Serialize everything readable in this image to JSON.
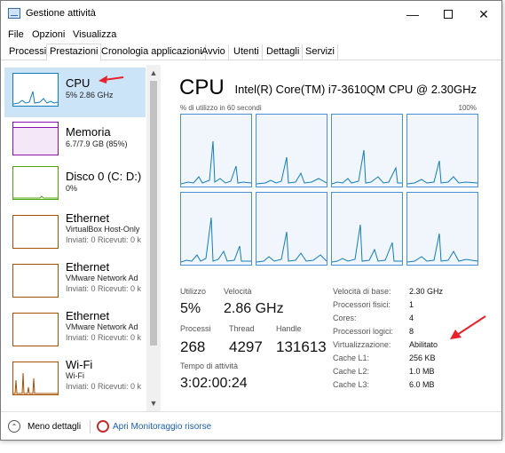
{
  "window": {
    "title": "Gestione attività"
  },
  "menu": [
    "File",
    "Opzioni",
    "Visualizza"
  ],
  "tabs": [
    "Processi",
    "Prestazioni",
    "Cronologia applicazioni",
    "Avvio",
    "Utenti",
    "Dettagli",
    "Servizi"
  ],
  "active_tab": "Prestazioni",
  "sidebar": {
    "items": [
      {
        "title": "CPU",
        "line1": "5% 2.86 GHz",
        "line2": "",
        "color": "#117dbb"
      },
      {
        "title": "Memoria",
        "line1": "6.7/7.9 GB (85%)",
        "line2": "",
        "color": "#8b12ae"
      },
      {
        "title": "Disco 0 (C: D:)",
        "line1": "0%",
        "line2": "",
        "color": "#4da60c"
      },
      {
        "title": "Ethernet",
        "line1": "VirtualBox Host-Only",
        "line2": "Inviati: 0 Ricevuti: 0 k",
        "color": "#a74f01"
      },
      {
        "title": "Ethernet",
        "line1": "VMware Network Ad",
        "line2": "Inviati: 0 Ricevuti: 0 k",
        "color": "#a74f01"
      },
      {
        "title": "Ethernet",
        "line1": "VMware Network Ad",
        "line2": "Inviati: 0 Ricevuti: 0 k",
        "color": "#a74f01"
      },
      {
        "title": "Wi-Fi",
        "line1": "Wi-Fi",
        "line2": "Inviati: 0 Ricevuti: 0 k",
        "color": "#a74f01"
      }
    ]
  },
  "main": {
    "title": "CPU",
    "model": "Intel(R) Core(TM) i7-3610QM CPU @ 2.30GHz",
    "graph_label_left": "% di utilizzo in 60 secondi",
    "graph_label_right": "100%",
    "stats": {
      "utilizzo_label": "Utilizzo",
      "utilizzo_value": "5%",
      "velocita_label": "Velocità",
      "velocita_value": "2.86 GHz",
      "processi_label": "Processi",
      "processi_value": "268",
      "thread_label": "Thread",
      "thread_value": "4297",
      "handle_label": "Handle",
      "handle_value": "131613",
      "uptime_label": "Tempo di attività",
      "uptime_value": "3:02:00:24"
    },
    "info": [
      {
        "label": "Velocità di base:",
        "value": "2.30 GHz"
      },
      {
        "label": "Processori fisici:",
        "value": "1"
      },
      {
        "label": "Cores:",
        "value": "4"
      },
      {
        "label": "Processori logici:",
        "value": "8"
      },
      {
        "label": "Virtualizzazione:",
        "value": "Abilitato"
      },
      {
        "label": "Cache L1:",
        "value": "256 KB"
      },
      {
        "label": "Cache L2:",
        "value": "1.0 MB"
      },
      {
        "label": "Cache L3:",
        "value": "6.0 MB"
      }
    ]
  },
  "footer": {
    "less_details": "Meno dettagli",
    "open_monitor": "Apri Monitoraggio risorse"
  },
  "colors": {
    "accent": "#117dbb",
    "selected_bg": "#cce4f7",
    "graph_line": "#4a90d9",
    "annotation": "#e8212a"
  }
}
